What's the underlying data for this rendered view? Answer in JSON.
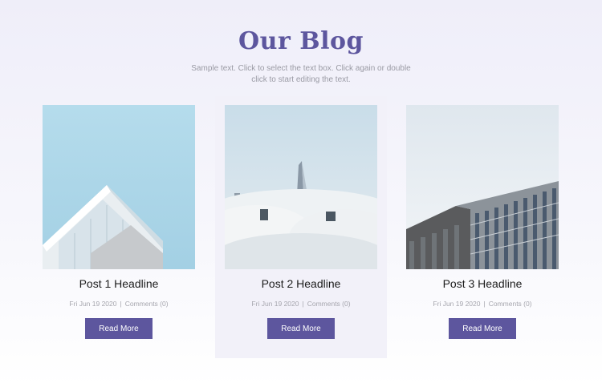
{
  "section": {
    "title": "Our Blog",
    "subtitle": "Sample text. Click to select the text box. Click again or double click to start editing the text."
  },
  "posts": [
    {
      "headline": "Post 1 Headline",
      "date": "Fri Jun 19 2020",
      "separator": "|",
      "comments": "Comments (0)",
      "button": "Read More",
      "image": "modern-building-blue-sky"
    },
    {
      "headline": "Post 2 Headline",
      "date": "Fri Jun 19 2020",
      "separator": "|",
      "comments": "Comments (0)",
      "button": "Read More",
      "image": "skyscrapers-above-clouds"
    },
    {
      "headline": "Post 3 Headline",
      "date": "Fri Jun 19 2020",
      "separator": "|",
      "comments": "Comments (0)",
      "button": "Read More",
      "image": "office-building-facade"
    }
  ],
  "colors": {
    "accent": "#5d569e",
    "headline": "#1c1c1c",
    "muted": "#a6a6ae",
    "featured_card_bg": "#f2f1f9"
  }
}
